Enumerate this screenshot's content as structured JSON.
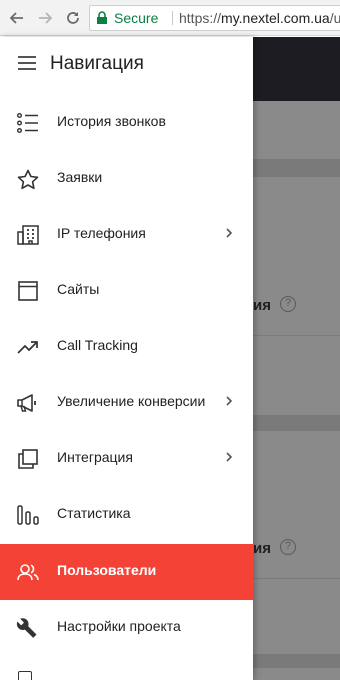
{
  "browser": {
    "secure_label": "Secure",
    "url_scheme": "https://",
    "url_domain": "my.nextel.com.ua",
    "url_path": "/u"
  },
  "background_page": {
    "text_1": "ия",
    "text_2": "ия",
    "hint": "?"
  },
  "drawer": {
    "title": "Навигация",
    "items": [
      {
        "label": "История звонков",
        "icon": "call-history-list-icon",
        "has_submenu": false
      },
      {
        "label": "Заявки",
        "icon": "star-icon",
        "has_submenu": false
      },
      {
        "label": "IP телефония",
        "icon": "office-building-icon",
        "has_submenu": true
      },
      {
        "label": "Сайты",
        "icon": "browser-window-icon",
        "has_submenu": false
      },
      {
        "label": "Call Tracking",
        "icon": "trending-up-icon",
        "has_submenu": false
      },
      {
        "label": "Увеличение конверсии",
        "icon": "megaphone-icon",
        "has_submenu": true
      },
      {
        "label": "Интеграция",
        "icon": "layers-icon",
        "has_submenu": true
      },
      {
        "label": "Статистика",
        "icon": "bar-chart-icon",
        "has_submenu": false
      },
      {
        "label": "Пользователи",
        "icon": "users-icon",
        "has_submenu": false,
        "active": true
      },
      {
        "label": "Настройки проекта",
        "icon": "wrench-icon",
        "has_submenu": false
      }
    ]
  },
  "colors": {
    "active_item_bg": "#f44336",
    "secure_green": "#0b8043",
    "overlay_gray": "#8a8a8a"
  }
}
